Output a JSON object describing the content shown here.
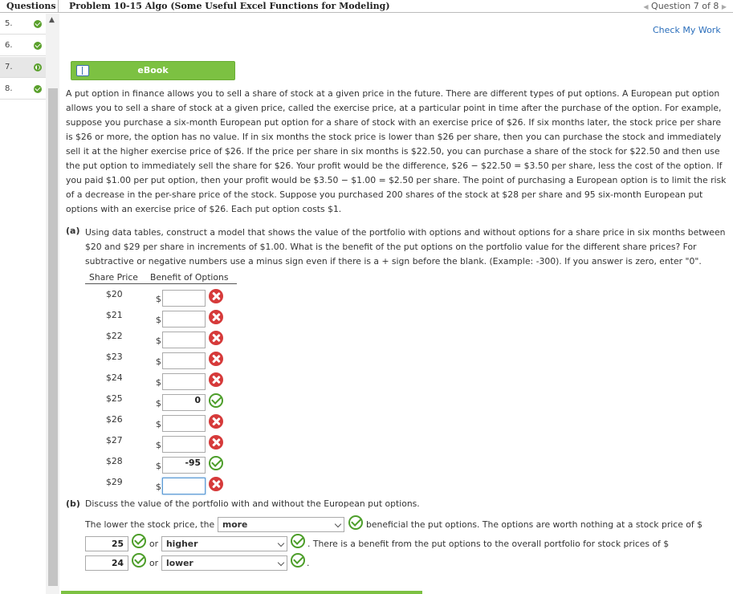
{
  "topbar": {
    "questions_label": "Questions",
    "problem_title": "Problem 10-15 Algo (Some Useful Excel Functions for Modeling)",
    "question_nav": "Question 7 of 8"
  },
  "sidebar": {
    "items": [
      {
        "number": "5.",
        "status": "complete"
      },
      {
        "number": "6.",
        "status": "complete"
      },
      {
        "number": "7.",
        "status": "current"
      },
      {
        "number": "8.",
        "status": "complete"
      }
    ]
  },
  "check_my_work": "Check My Work",
  "ebook_label": "eBook",
  "intro_text": "A put option in finance allows you to sell a share of stock at a given price in the future. There are different types of put options. A European put option allows you to sell a share of stock at a given price, called the exercise price, at a particular point in time after the purchase of the option. For example, suppose you purchase a six-month European put option for a share of stock with an exercise price of $26. If six months later, the stock price per share is $26 or more, the option has no value. If in six months the stock price is lower than $26 per share, then you can purchase the stock and immediately sell it at the higher exercise price of $26. If the price per share in six months is $22.50, you can purchase a share of the stock for $22.50 and then use the put option to immediately sell the share for $26. Your profit would be the difference, $26 − $22.50 = $3.50 per share, less the cost of the option. If you paid $1.00 per put option, then your profit would be $3.50 − $1.00 = $2.50 per share. The point of purchasing a European option is to limit the risk of a decrease in the per-share price of the stock. Suppose you purchased 200 shares of the stock at $28 per share and 95 six-month European put options with an exercise price of $26. Each put option costs $1.",
  "part_a": {
    "label": "(a)",
    "text": "Using data tables, construct a model that shows the value of the portfolio with options and without options for a share price in six months between $20 and $29 per share in increments of $1.00. What is the benefit of the put options on the portfolio value for the different share prices? For subtractive or negative numbers use a minus sign even if there is a + sign before the blank. (Example: -300). If you answer is zero, enter \"0\".",
    "col_price": "Share Price",
    "col_benefit": "Benefit of Options",
    "currency": "$",
    "rows": [
      {
        "price": "$20",
        "value": "",
        "result": "incorrect"
      },
      {
        "price": "$21",
        "value": "",
        "result": "incorrect"
      },
      {
        "price": "$22",
        "value": "",
        "result": "incorrect"
      },
      {
        "price": "$23",
        "value": "",
        "result": "incorrect"
      },
      {
        "price": "$24",
        "value": "",
        "result": "incorrect"
      },
      {
        "price": "$25",
        "value": "0",
        "result": "correct"
      },
      {
        "price": "$26",
        "value": "",
        "result": "incorrect"
      },
      {
        "price": "$27",
        "value": "",
        "result": "incorrect"
      },
      {
        "price": "$28",
        "value": "-95",
        "result": "correct"
      },
      {
        "price": "$29",
        "value": "",
        "result": "incorrect"
      }
    ]
  },
  "part_b": {
    "label": "(b)",
    "text": "Discuss the value of the portfolio with and without the European put options.",
    "s1_prefix": "The lower the stock price, the",
    "s1_select": "more",
    "s1_suffix": "beneficial the put options. The options are worth nothing at a stock price of $",
    "v1": "25",
    "or1": "or",
    "select2": "higher",
    "s2_suffix": ". There is a benefit from the put options to the overall portfolio for stock prices of $",
    "v2": "24",
    "or2": "or",
    "select3": "lower",
    "end": "."
  },
  "colors": {
    "accent_green": "#7cc142",
    "link_blue": "#2a6ebb",
    "correct_green": "#4d9e2a",
    "incorrect_red": "#d63a3a"
  }
}
